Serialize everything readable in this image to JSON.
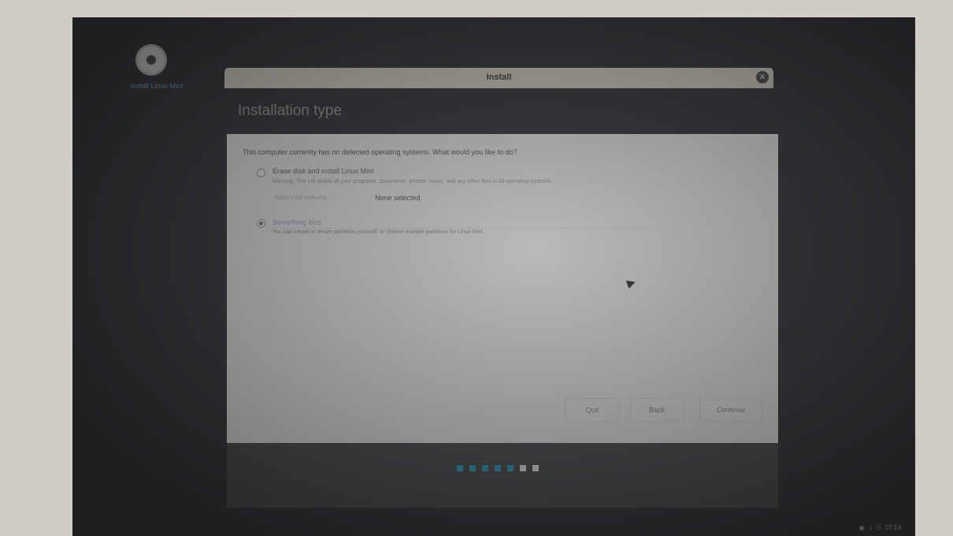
{
  "sidebar": {
    "brand_label": "Install Linux Mint"
  },
  "window": {
    "title": "Install",
    "close_icon": "close-icon"
  },
  "page": {
    "heading": "Installation type"
  },
  "panel": {
    "question": "This computer currently has no detected operating systems. What would you like to do?",
    "option_erase": {
      "label": "Erase disk and install Linux Mint",
      "description": "Warning: This will delete all your programs, documents, photos, music, and any other files in all operating systems.",
      "advanced_button": "Advanced features...",
      "advanced_value": "None selected",
      "selected": false
    },
    "option_something_else": {
      "label": "Something else",
      "description": "You can create or resize partitions yourself, or choose multiple partitions for Linux Mint.",
      "selected": true
    }
  },
  "buttons": {
    "quit": "Quit",
    "back": "Back",
    "continue": "Continue"
  },
  "progress": {
    "steps_total": 7,
    "steps_done": 5,
    "done_color": "#2f9bb5",
    "todo_color": "#eaeaea"
  },
  "tray": {
    "icons": [
      "network-icon",
      "volume-icon",
      "battery-icon"
    ],
    "time": "07:13"
  },
  "colors": {
    "accent": "#6ea6c9",
    "screen": "#2e2f32"
  }
}
